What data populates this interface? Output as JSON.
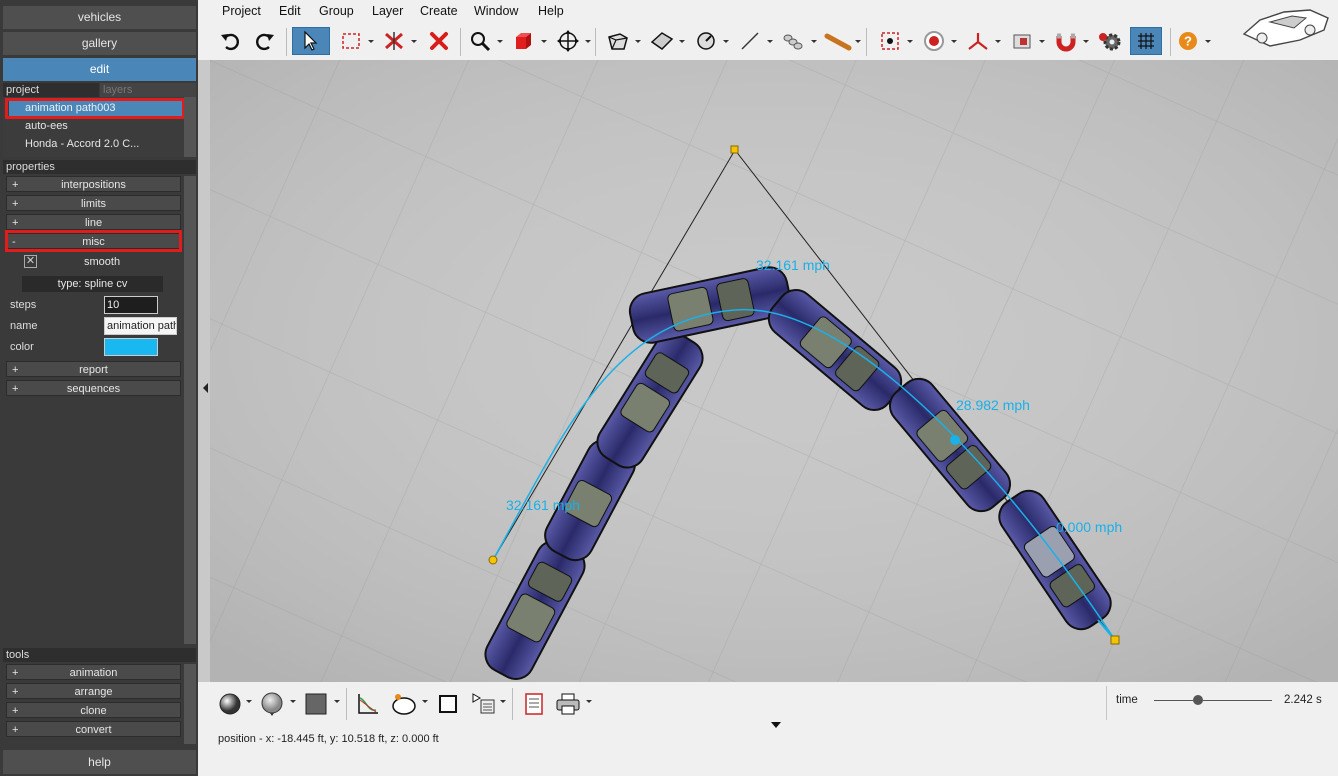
{
  "left_panel": {
    "nav": [
      "vehicles",
      "gallery",
      "edit"
    ],
    "project_tabs": [
      "project",
      "layers"
    ],
    "project_items": [
      "animation path003",
      "auto-ees",
      "Honda - Accord 2.0 C..."
    ],
    "properties_label": "properties",
    "property_groups_top": [
      {
        "sign": "+",
        "label": "interpositions"
      },
      {
        "sign": "+",
        "label": "limits"
      },
      {
        "sign": "+",
        "label": "line"
      },
      {
        "sign": "-",
        "label": "misc"
      }
    ],
    "smooth_label": "smooth",
    "type_label": "type: spline cv",
    "fields": {
      "steps_label": "steps",
      "steps_value": "10",
      "name_label": "name",
      "name_value": "animation path",
      "color_label": "color",
      "color_value": "#19b8f0"
    },
    "property_groups_bottom": [
      {
        "sign": "+",
        "label": "report"
      },
      {
        "sign": "+",
        "label": "sequences"
      }
    ],
    "tools_label": "tools",
    "tools": [
      {
        "sign": "+",
        "label": "animation"
      },
      {
        "sign": "+",
        "label": "arrange"
      },
      {
        "sign": "+",
        "label": "clone"
      },
      {
        "sign": "+",
        "label": "convert"
      }
    ],
    "help": "help"
  },
  "menu": [
    "Project",
    "Edit",
    "Group",
    "Layer",
    "Create",
    "Window",
    "Help"
  ],
  "toolbar_icons": [
    "undo-icon",
    "redo-icon",
    "select-arrow-icon",
    "rectangle-select-icon",
    "delete-vertex-icon",
    "delete-icon",
    "zoom-icon",
    "cube-icon",
    "move-icon",
    "box-icon",
    "plane-icon",
    "measure-icon",
    "line-icon",
    "spring-icon",
    "stick-icon",
    "camera-target-icon",
    "target-icon",
    "axis-icon",
    "render-icon",
    "magnet-icon",
    "settings-gear-icon",
    "grid-icon",
    "help-icon",
    "car-logo-icon"
  ],
  "viewport": {
    "speed_labels": [
      "32.161 mph",
      "28.982 mph",
      "32.161 mph",
      "0.000 mph"
    ],
    "accent": "#1ab0e8"
  },
  "bottom": {
    "status": "position - x: -18.445 ft, y: 10.518 ft, z: 0.000 ft",
    "time_label": "time",
    "time_value": "2.242 s",
    "time_fraction": 0.37
  }
}
